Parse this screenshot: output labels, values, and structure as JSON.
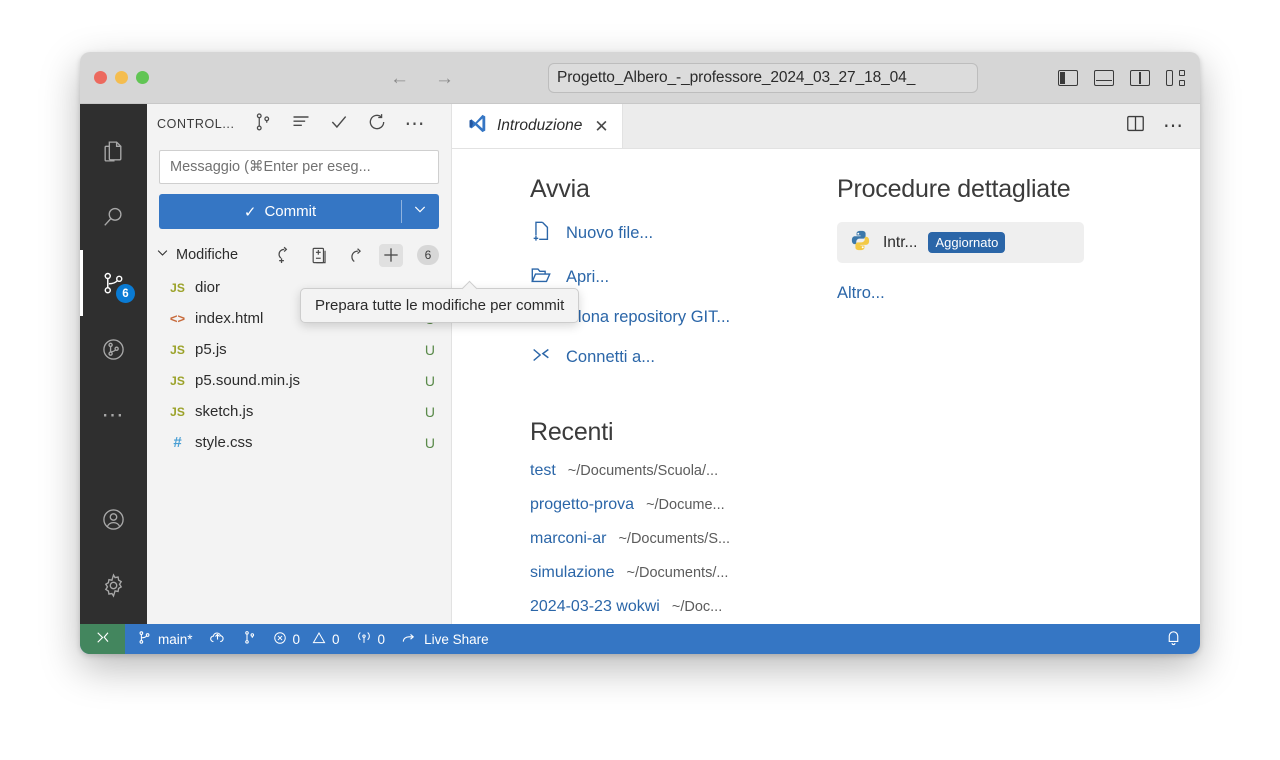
{
  "titlebar": {
    "command_center_text": "Progetto_Albero_-_professore_2024_03_27_18_04_",
    "back_label": "←",
    "forward_label": "→",
    "layout_icons": [
      "toggle-primary-sidebar",
      "toggle-panel",
      "toggle-secondary-sidebar",
      "customize-layout"
    ]
  },
  "activity_bar": {
    "items": [
      {
        "name": "explorer",
        "badge": ""
      },
      {
        "name": "search",
        "badge": ""
      },
      {
        "name": "source-control",
        "badge": "6"
      },
      {
        "name": "run-and-debug",
        "badge": ""
      },
      {
        "name": "more-views",
        "badge": ""
      }
    ],
    "bottom_items": [
      {
        "name": "accounts"
      },
      {
        "name": "manage-settings"
      }
    ]
  },
  "sidebar": {
    "title": "CONTROL...",
    "header_actions": [
      "view-as-tree-icon",
      "list-icon",
      "commit-check-icon",
      "refresh-icon",
      "more-actions-icon"
    ],
    "message_input": {
      "placeholder": "Messaggio (⌘Enter per eseg...",
      "value": ""
    },
    "commit_button": {
      "label": "Commit",
      "check": "✓",
      "dropdown": "⌄"
    },
    "changes": {
      "label": "Modifiche",
      "count": "6",
      "actions": [
        "stash-changes-icon",
        "open-changes-icon",
        "discard-all-changes-icon",
        "stage-all-changes-icon"
      ]
    },
    "files": [
      {
        "icon": "js",
        "icon_label": "JS",
        "name": "dior",
        "status": ""
      },
      {
        "icon": "html",
        "icon_label": "<>",
        "name": "index.html",
        "status": "U"
      },
      {
        "icon": "js",
        "icon_label": "JS",
        "name": "p5.js",
        "status": "U"
      },
      {
        "icon": "js",
        "icon_label": "JS",
        "name": "p5.sound.min.js",
        "status": "U"
      },
      {
        "icon": "js",
        "icon_label": "JS",
        "name": "sketch.js",
        "status": "U"
      },
      {
        "icon": "css",
        "icon_label": "#",
        "name": "style.css",
        "status": "U"
      }
    ],
    "tooltip": "Prepara tutte le modifiche per commit"
  },
  "editor": {
    "tab": {
      "label": "Introduzione",
      "close": "✕",
      "icon": "vscode-logo-icon"
    },
    "toolbar": [
      "split-editor-icon",
      "more-actions-icon"
    ]
  },
  "welcome": {
    "start": {
      "heading": "Avvia",
      "items": [
        {
          "label": "Nuovo file...",
          "icon": "new-file-icon"
        },
        {
          "label": "Apri...",
          "icon": "open-folder-icon"
        },
        {
          "label": "Clona repository GIT...",
          "icon": "git-clone-icon"
        },
        {
          "label": "Connetti a...",
          "icon": "remote-connect-icon"
        }
      ]
    },
    "recent": {
      "heading": "Recenti",
      "items": [
        {
          "name": "test",
          "path": "~/Documents/Scuola/..."
        },
        {
          "name": "progetto-prova",
          "path": "~/Docume..."
        },
        {
          "name": "marconi-ar",
          "path": "~/Documents/S..."
        },
        {
          "name": "simulazione",
          "path": "~/Documents/..."
        },
        {
          "name": "2024-03-23 wokwi",
          "path": "~/Doc..."
        }
      ]
    },
    "walkthroughs": {
      "heading": "Procedure dettagliate",
      "card": {
        "title": "Intr...",
        "badge": "Aggiornato",
        "icon": "python-icon"
      },
      "more_label": "Altro..."
    }
  },
  "statusbar": {
    "remote_icon": "remote-indicator-icon",
    "branch": "main*",
    "sync_icon": "sync-cloud-icon",
    "graph_icon": "source-control-graph-icon",
    "errors": "0",
    "warnings": "0",
    "ports": "0",
    "live_share": "Live Share",
    "notifications_icon": "bell-icon"
  },
  "colors": {
    "accent_blue": "#3576c4",
    "link_blue": "#2b66a8",
    "status_green": "#5a8a4a",
    "remote_green": "#43865e",
    "badge_blue": "#0a7bd4"
  }
}
